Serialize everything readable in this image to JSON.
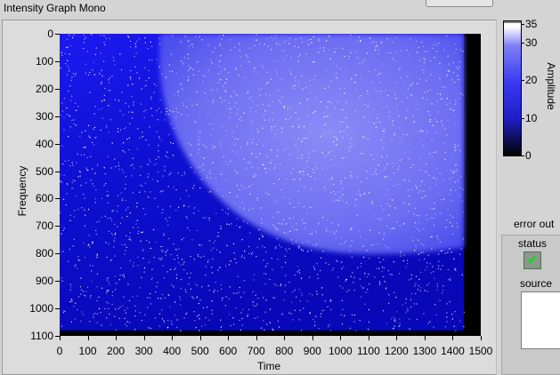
{
  "graph": {
    "title": "Intensity Graph Mono",
    "x_axis": {
      "title": "Time",
      "ticks": [
        "0",
        "100",
        "200",
        "300",
        "400",
        "500",
        "600",
        "700",
        "800",
        "900",
        "1000",
        "1100",
        "1200",
        "1300",
        "1400",
        "1500"
      ]
    },
    "y_axis": {
      "title": "Frequency",
      "ticks": [
        "0",
        "100",
        "200",
        "300",
        "400",
        "500",
        "600",
        "700",
        "800",
        "900",
        "1000",
        "1100"
      ]
    },
    "color_scale": {
      "title": "Amplitude",
      "ticks": [
        "35",
        "30",
        "20",
        "10",
        "0"
      ],
      "colors": [
        "#000000",
        "#1f1fc8",
        "#3a3af0",
        "#8080f6",
        "#ffffff"
      ]
    },
    "data_extent": {
      "x_max": 1440,
      "y_max": 1080
    }
  },
  "error_cluster": {
    "label": "error out",
    "status_label": "status",
    "status_value": "✔",
    "source_label": "source",
    "source_value": ""
  }
}
